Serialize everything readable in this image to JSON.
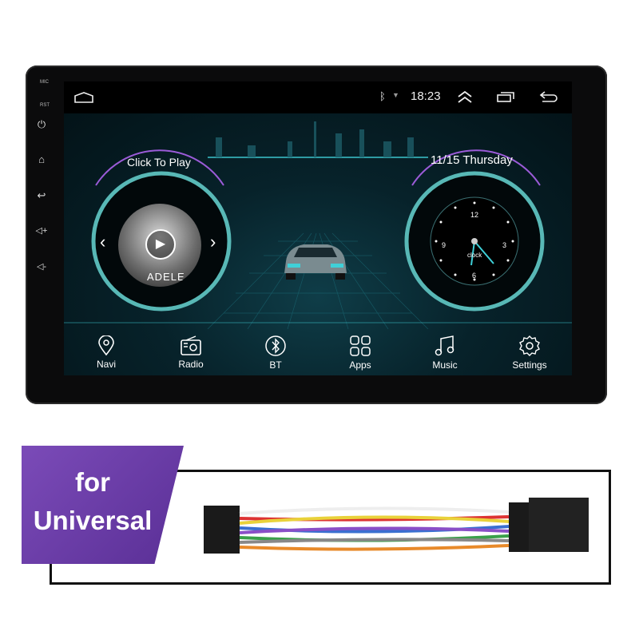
{
  "device": {
    "mic_label": "MIC",
    "rst_label": "RST",
    "side_buttons": [
      "power-icon",
      "home-icon",
      "back-icon",
      "volume-up-icon",
      "volume-down-icon"
    ]
  },
  "status_bar": {
    "time": "18:23",
    "icons": [
      "home-outline-icon",
      "bluetooth-icon",
      "wifi-icon",
      "chevron-up-double-icon",
      "recent-apps-icon",
      "back-arrow-icon"
    ]
  },
  "music_widget": {
    "title": "Click To Play",
    "album_text": "ADELE"
  },
  "clock_widget": {
    "date": "11/15 Thursday",
    "dial_numbers": [
      "12",
      "3",
      "6",
      "9"
    ],
    "dial_label": "clock"
  },
  "dock": [
    {
      "label": "Navi",
      "icon": "location-pin-icon"
    },
    {
      "label": "Radio",
      "icon": "radio-icon"
    },
    {
      "label": "BT",
      "icon": "bluetooth-icon"
    },
    {
      "label": "Apps",
      "icon": "apps-grid-icon"
    },
    {
      "label": "Music",
      "icon": "music-note-icon"
    },
    {
      "label": "Settings",
      "icon": "gear-icon"
    }
  ],
  "promo": {
    "line1": "for",
    "line2": "Universal"
  },
  "colors": {
    "accent": "#3fd0d8",
    "tag": "#6a3aa8"
  }
}
